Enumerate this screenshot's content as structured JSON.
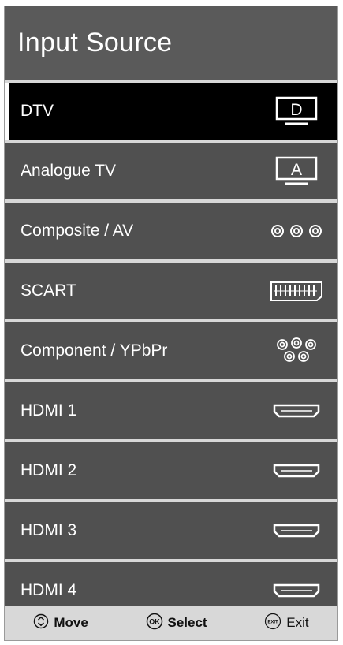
{
  "header": {
    "title": "Input Source"
  },
  "sources": [
    {
      "label": "DTV",
      "icon": "dtv-icon",
      "selected": true
    },
    {
      "label": "Analogue TV",
      "icon": "analogue-tv-icon"
    },
    {
      "label": "Composite / AV",
      "icon": "composite-icon"
    },
    {
      "label": "SCART",
      "icon": "scart-icon"
    },
    {
      "label": "Component / YPbPr",
      "icon": "component-icon"
    },
    {
      "label": "HDMI 1",
      "icon": "hdmi-icon"
    },
    {
      "label": "HDMI 2",
      "icon": "hdmi-icon"
    },
    {
      "label": "HDMI 3",
      "icon": "hdmi-icon"
    },
    {
      "label": "HDMI 4",
      "icon": "hdmi-icon"
    }
  ],
  "icon_text": {
    "dtv": "D",
    "analogue": "A"
  },
  "footer": {
    "move_label": "Move",
    "select_icon_text": "OK",
    "select_label": "Select",
    "exit_icon_text": "EXIT",
    "exit_label": "Exit"
  },
  "colors": {
    "header_bg": "#5a5a5a",
    "item_bg": "#505050",
    "selected_bg": "#000000",
    "footer_bg": "#d8d8d8"
  }
}
